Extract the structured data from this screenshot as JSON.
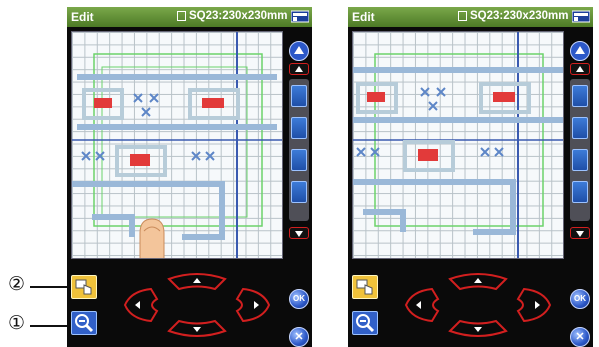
{
  "callouts": {
    "one": "①",
    "two": "②"
  },
  "left_screen": {
    "title": "Edit",
    "hoop_label": "SQ23:230x230mm",
    "ok_label": "OK"
  },
  "right_screen": {
    "title": "Edit",
    "hoop_label": "SQ23:230x230mm",
    "ok_label": "OK"
  },
  "colors": {
    "titlebar": "#5e8f33",
    "grid_line": "#b8c2c8",
    "stitch_blue": "#8fb1d6",
    "stitch_red": "#e23a3a",
    "frame_green": "#6bd36b",
    "arrow_outline": "#d21f1f",
    "tool_button": "#2d63c4",
    "zoom_button": "#3160c8",
    "hand_button": "#f0c23a"
  },
  "icons": {
    "hoop": "hoop-icon",
    "machine": "machine-icon",
    "hand": "hand-icon",
    "zoom": "zoom-out-icon",
    "finger": "finger-icon"
  }
}
